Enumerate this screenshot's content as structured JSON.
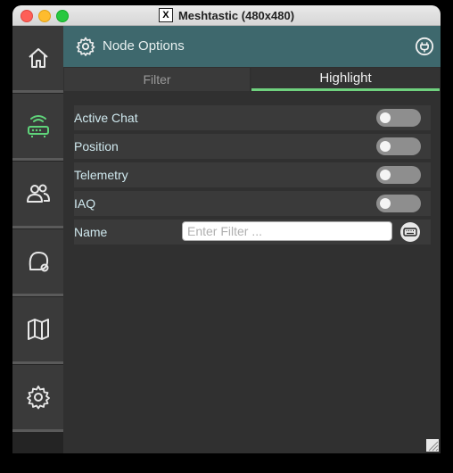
{
  "window": {
    "title": "Meshtastic (480x480)",
    "x_logo": "X"
  },
  "sidebar": {
    "items": [
      {
        "name": "home",
        "icon": "home-icon"
      },
      {
        "name": "nodes",
        "icon": "router-icon",
        "active": true
      },
      {
        "name": "groups",
        "icon": "users-icon"
      },
      {
        "name": "messages",
        "icon": "chat-icon"
      },
      {
        "name": "map",
        "icon": "map-icon"
      },
      {
        "name": "settings",
        "icon": "gear-icon"
      }
    ]
  },
  "header": {
    "title": "Node Options",
    "icon": "gear-icon",
    "right_icon": "plug-icon"
  },
  "tabs": [
    {
      "label": "Filter",
      "selected": false
    },
    {
      "label": "Highlight",
      "selected": true
    }
  ],
  "options": [
    {
      "label": "Active Chat",
      "enabled": false
    },
    {
      "label": "Position",
      "enabled": false
    },
    {
      "label": "Telemetry",
      "enabled": false
    },
    {
      "label": "IAQ",
      "enabled": false
    }
  ],
  "name_filter": {
    "label": "Name",
    "value": "",
    "placeholder": "Enter Filter ..."
  },
  "colors": {
    "accent": "#6fd17e",
    "header": "#3e686d",
    "active_icon": "#5fd37a"
  }
}
